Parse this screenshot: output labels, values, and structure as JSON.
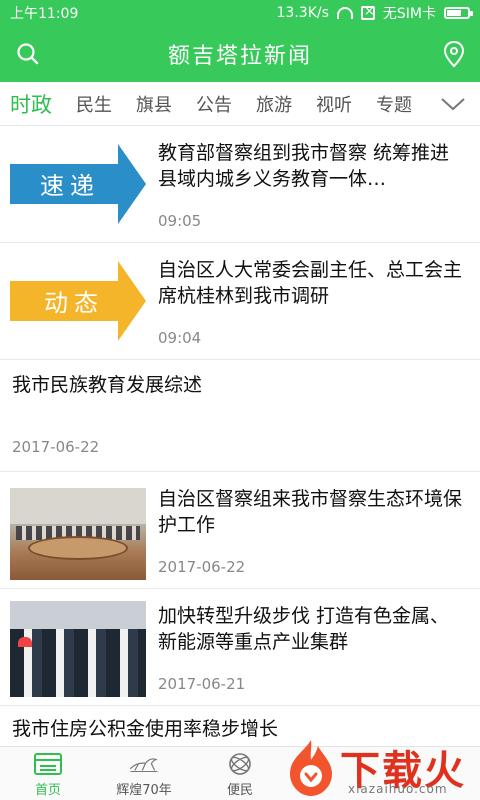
{
  "status_bar": {
    "time": "上午11:09",
    "speed": "13.3K/s",
    "sim": "无SIM卡"
  },
  "header": {
    "title": "额吉塔拉新闻",
    "search_icon": "search-icon",
    "location_icon": "location-pin-icon"
  },
  "tabs": [
    "时政",
    "民生",
    "旗县",
    "公告",
    "旅游",
    "视听",
    "专题"
  ],
  "news": [
    {
      "type": "image",
      "badge": "速递",
      "badge_color": "#2a8fc9",
      "title": "教育部督察组到我市督察 统筹推进县域内城乡义务教育一体…",
      "time": "09:05"
    },
    {
      "type": "image",
      "badge": "动态",
      "badge_color": "#f5b52a",
      "title": "自治区人大常委会副主任、总工会主席杭桂林到我市调研",
      "time": "09:04"
    },
    {
      "type": "text",
      "title": "我市民族教育发展综述",
      "time": "2017-06-22"
    },
    {
      "type": "image",
      "title": "自治区督察组来我市督察生态环境保护工作",
      "time": "2017-06-22"
    },
    {
      "type": "image",
      "title": "加快转型升级步伐 打造有色金属、新能源等重点产业集群",
      "time": "2017-06-21"
    },
    {
      "type": "text",
      "title": "我市住房公积金使用率稳步增长"
    }
  ],
  "bottom_nav": [
    {
      "label": "首页",
      "icon": "home-icon"
    },
    {
      "label": "辉煌70年",
      "icon": "horse-icon"
    },
    {
      "label": "便民",
      "icon": "globe-icon"
    }
  ],
  "watermark": {
    "text": "下载火",
    "sub": "xiazaihuo.com"
  },
  "colors": {
    "brand_green": "#37c95a",
    "active_green": "#2fbf4f"
  }
}
